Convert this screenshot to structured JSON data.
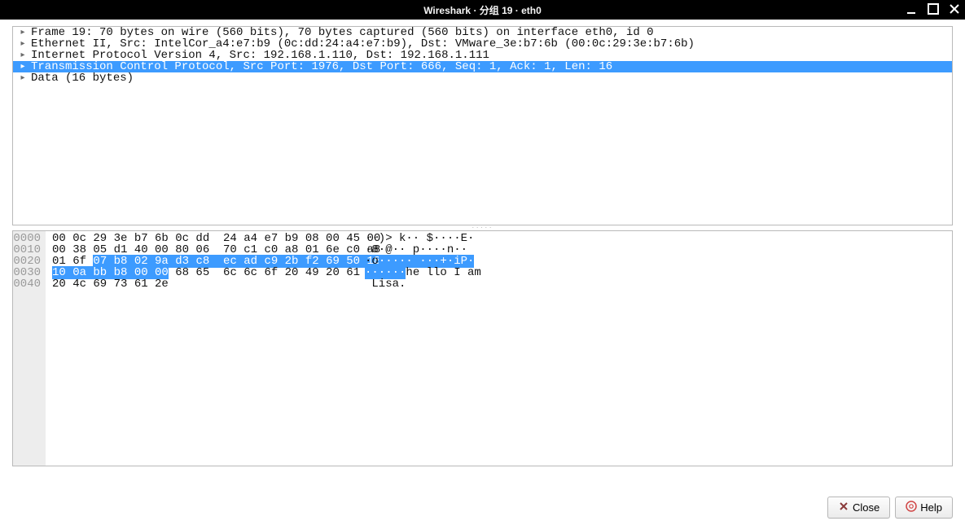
{
  "window": {
    "title": "Wireshark · 分组 19 · eth0"
  },
  "tree": {
    "items": [
      {
        "label": "Frame 19: 70 bytes on wire (560 bits), 70 bytes captured (560 bits) on interface eth0, id 0",
        "selected": false
      },
      {
        "label": "Ethernet II, Src: IntelCor_a4:e7:b9 (0c:dd:24:a4:e7:b9), Dst: VMware_3e:b7:6b (00:0c:29:3e:b7:6b)",
        "selected": false
      },
      {
        "label": "Internet Protocol Version 4, Src: 192.168.1.110, Dst: 192.168.1.111",
        "selected": false
      },
      {
        "label": "Transmission Control Protocol, Src Port: 1976, Dst Port: 666, Seq: 1, Ack: 1, Len: 16",
        "selected": true
      },
      {
        "label": "Data (16 bytes)",
        "selected": false
      }
    ]
  },
  "hex": {
    "offsets": [
      "0000",
      "0010",
      "0020",
      "0030",
      "0040"
    ],
    "bytes": [
      {
        "pre": "00 0c 29 3e b7 6b 0c dd  24 a4 e7 b9 08 00 45 00",
        "hl": "",
        "mid": "",
        "hl2": "",
        "post": ""
      },
      {
        "pre": "00 38 05 d1 40 00 80 06  70 c1 c0 a8 01 6e c0 a8",
        "hl": "",
        "mid": "",
        "hl2": "",
        "post": ""
      },
      {
        "pre": "01 6f ",
        "hl": "07 b8 02 9a d3 c8  ec ad c9 2b f2 69 50 18",
        "mid": "",
        "hl2": "",
        "post": ""
      },
      {
        "pre": "",
        "hl": "10 0a bb b8 00 00",
        "mid": " 68 65  6c 6c 6f 20 49 20 61 6d",
        "hl2": "",
        "post": ""
      },
      {
        "pre": "20 4c 69 73 61 2e",
        "hl": "",
        "mid": "",
        "hl2": "",
        "post": ""
      }
    ],
    "ascii": [
      {
        "pre": "··)> k·· $····E·",
        "hl": "",
        "post": ""
      },
      {
        "pre": "·8·@·· p····n··",
        "hl": "",
        "post": ""
      },
      {
        "pre": "·o",
        "hl": "····· ···+·iP·",
        "post": ""
      },
      {
        "pre": "",
        "hl": "······",
        "post": "he llo I am"
      },
      {
        "pre": " Lisa.",
        "hl": "",
        "post": ""
      }
    ]
  },
  "buttons": {
    "close": "Close",
    "help": "Help"
  }
}
